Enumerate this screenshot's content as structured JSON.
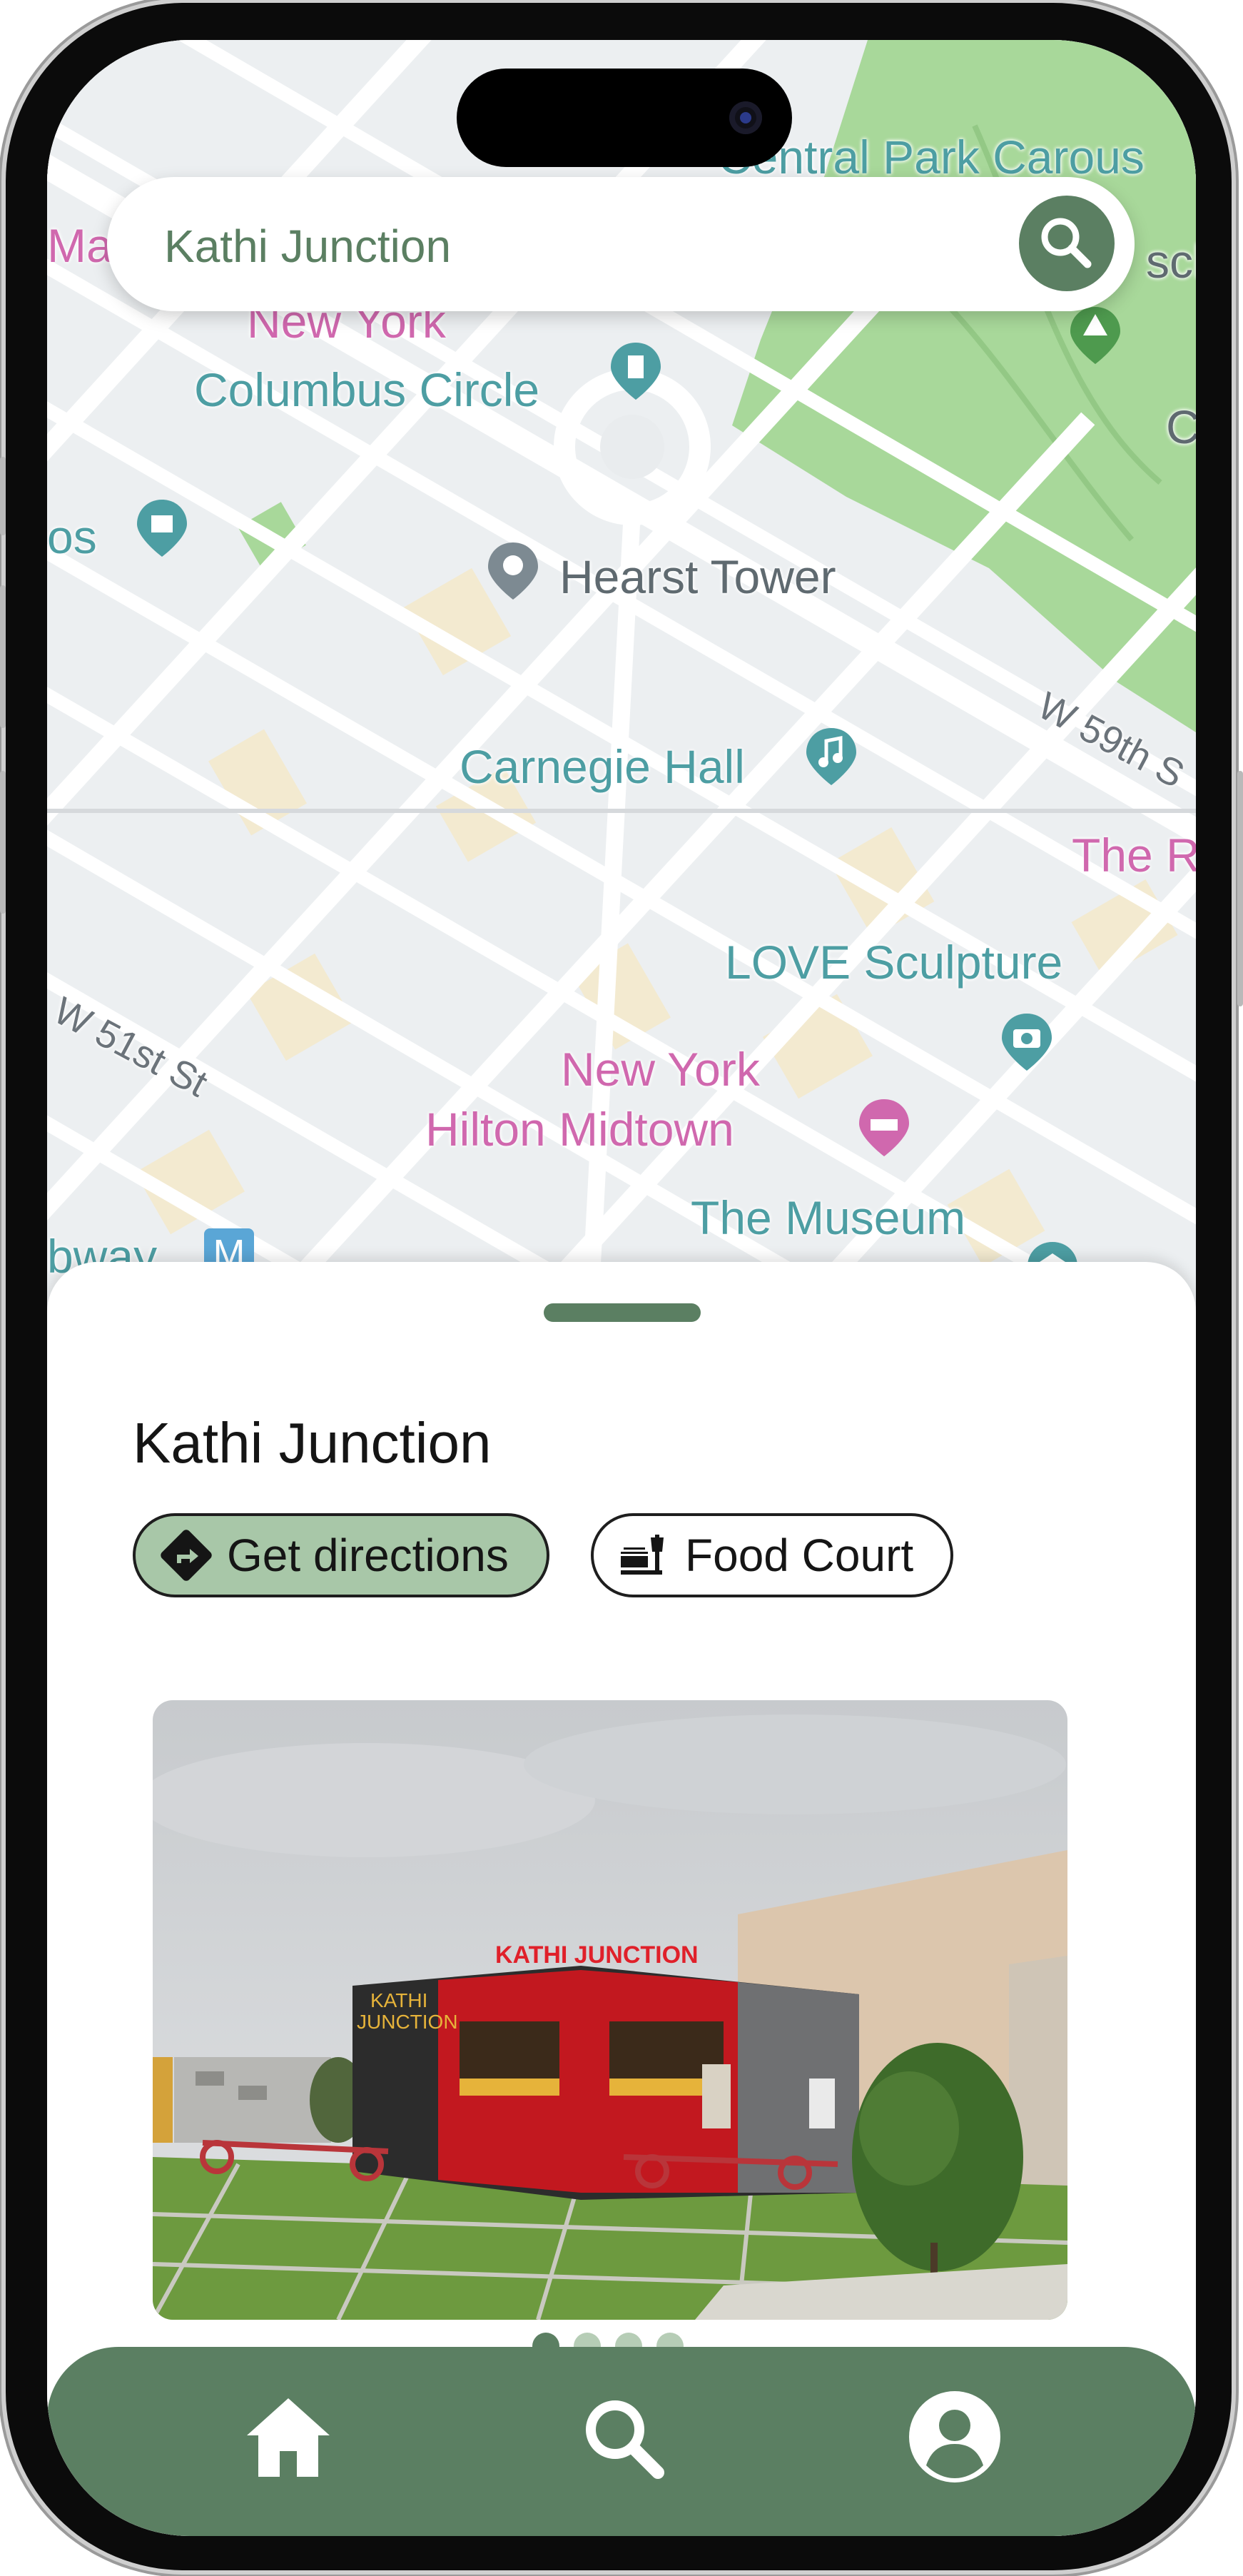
{
  "search": {
    "query": "Kathi Junction"
  },
  "map": {
    "labels": {
      "central_park": "Central Park Carous",
      "columbus_circle": "Columbus Circle",
      "hearst_tower": "Hearst Tower",
      "carnegie_hall": "Carnegie Hall",
      "love_sculpture": "LOVE Sculpture",
      "hilton_1": "New York",
      "hilton_2": "Hilton Midtown",
      "museum": "The Museum",
      "w59": "W 59th S",
      "w51": "W 51st St",
      "subway": "bway",
      "new_york": "New York",
      "ma": "Ma",
      "the_r": "The R",
      "os": "os",
      "c": "C",
      "sch": "sch"
    },
    "colors": {
      "park": "#a8d89a",
      "road": "#ffffff",
      "block": "#e6e9ec",
      "poi_teal": "#4d9ea3",
      "poi_pink": "#d068ae"
    }
  },
  "sheet": {
    "title": "Kathi Junction",
    "chips": {
      "directions": "Get directions",
      "category": "Food Court"
    },
    "photo": {
      "sign_text": "KATHI JUNCTION",
      "side_text_1": "KATHI",
      "side_text_2": "JUNCTION"
    },
    "carousel": {
      "count": 4,
      "active": 1
    }
  },
  "nav": {
    "items": [
      "home-icon",
      "search-icon",
      "profile-icon"
    ]
  },
  "colors": {
    "accent": "#5b7f62",
    "chip_active": "#a8c7a8"
  }
}
